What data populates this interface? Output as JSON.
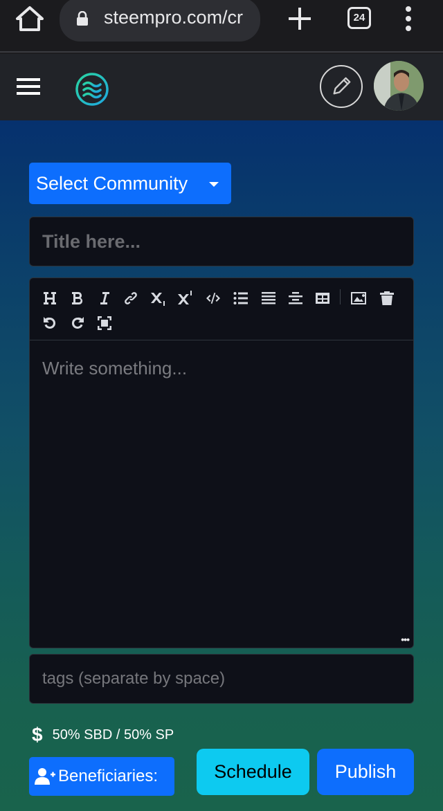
{
  "browser": {
    "url": "steempro.com/create",
    "url_visible": "steempro.com/cr",
    "tab_count": "24"
  },
  "header": {
    "logo": "steempro-logo",
    "user": "user-avatar"
  },
  "form": {
    "community_label": "Select Community",
    "title_placeholder": "Title here...",
    "body_placeholder": "Write something...",
    "tags_placeholder": "tags (separate by space)",
    "payout": "50% SBD / 50% SP",
    "beneficiaries_label": "Beneficiaries:",
    "schedule_label": "Schedule",
    "publish_label": "Publish"
  },
  "toolbar": {
    "tools": [
      "heading",
      "bold",
      "italic",
      "link",
      "subscript",
      "superscript",
      "code",
      "unordered-list",
      "justify",
      "align-center",
      "table",
      "image",
      "delete",
      "undo",
      "redo",
      "fullscreen"
    ]
  },
  "colors": {
    "primary": "#0d6efd",
    "info": "#0dcaf0",
    "logo_accent": "#2bc8b6"
  }
}
